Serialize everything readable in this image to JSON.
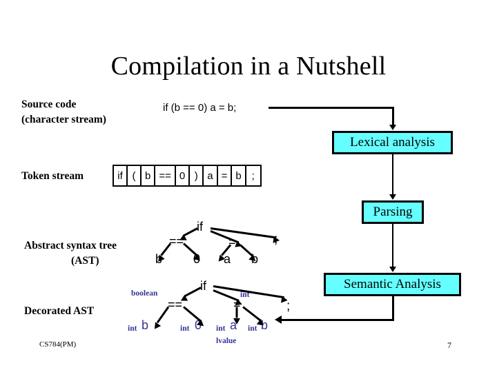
{
  "slide": {
    "title": "Compilation in a Nutshell",
    "footer": {
      "course": "CS784(PM)",
      "page_number": "7"
    },
    "colors": {
      "stage_fill": "#66FFFF",
      "stage_border": "#000000",
      "annotation": "#333399",
      "text": "#000000",
      "background": "#FFFFFF"
    }
  },
  "labels": {
    "source_code_line1": "Source code",
    "source_code_line2": "(character stream)",
    "token_stream": "Token stream",
    "ast_line1": "Abstract syntax tree",
    "ast_line2": "(AST)",
    "decorated_ast": "Decorated AST"
  },
  "source_code": {
    "text": "if (b == 0) a = b;"
  },
  "token_stream": {
    "tokens": [
      "if",
      "(",
      "b",
      "==",
      "0",
      ")",
      "a",
      "=",
      "b",
      ";"
    ]
  },
  "stages": [
    {
      "id": "lexical",
      "label": "Lexical analysis"
    },
    {
      "id": "parsing",
      "label": "Parsing"
    },
    {
      "id": "semantic",
      "label": "Semantic Analysis"
    }
  ],
  "ast": {
    "root": "if",
    "nodes": {
      "if": "if",
      "eqeq": "==",
      "eq": "=",
      "semi": ";",
      "b_left": "b",
      "zero": "0",
      "a": "a",
      "b_right": "b"
    }
  },
  "decorated_ast": {
    "nodes": {
      "if": "if",
      "eqeq": "==",
      "eq": "=",
      "semi": ";"
    },
    "annotations": {
      "eqeq_type": "boolean",
      "eq_type": "int",
      "b_left_type": "int",
      "zero_type": "int",
      "a_type": "int",
      "b_right_type": "int",
      "a_lvalue": "lvalue"
    },
    "leaves": {
      "b_left": "b",
      "zero": "0",
      "a": "a",
      "b_right": "b"
    }
  }
}
